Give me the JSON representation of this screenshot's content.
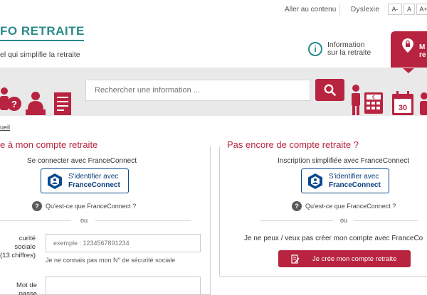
{
  "topbar": {
    "skip_link": "Aller au contenu",
    "dyslexia": "Dyslexie",
    "font_sizes": [
      "A-",
      "A",
      "A+"
    ]
  },
  "brand": {
    "title": "FO RETRAITE",
    "subtitle": "el qui simplifie la retraite"
  },
  "header": {
    "info_line1": "Information",
    "info_line2": "sur la retraite",
    "account_tab_line1": "M",
    "account_tab_line2": "re"
  },
  "search": {
    "placeholder": "Rechercher une information ..."
  },
  "breadcrumb": "ueil",
  "left_panel": {
    "title": "e à mon compte retraite",
    "connect_with": "Se connecter avec FranceConnect",
    "fc_line1": "S'identifier avec",
    "fc_line2": "FranceConnect",
    "what_is_fc": "Qu'est-ce que FranceConnect ?",
    "or": "ou",
    "ssn_label_line1": "curité sociale",
    "ssn_label_line2": "(13 chiffres)",
    "ssn_placeholder": "exemple : 1234567891234",
    "ssn_forgot": "Je ne connais pas mon N° de sécurité sociale",
    "password_label": "Mot de passe"
  },
  "right_panel": {
    "title": "Pas encore de compte retraite ?",
    "signup_with": "Inscription simplifiée avec FranceConnect",
    "fc_line1": "S'identifier avec",
    "fc_line2": "FranceConnect",
    "what_is_fc": "Qu'est-ce que FranceConnect ?",
    "or": "ou",
    "cannot_create": "Je ne peux / veux pas créer mon compte avec FranceCo",
    "create_button": "Je crée mon compte retraite"
  },
  "colors": {
    "accent": "#b8243f",
    "brand_teal": "#2b8a8a",
    "franceconnect_blue": "#0a4b8f",
    "band_gray": "#e9e9e9"
  }
}
